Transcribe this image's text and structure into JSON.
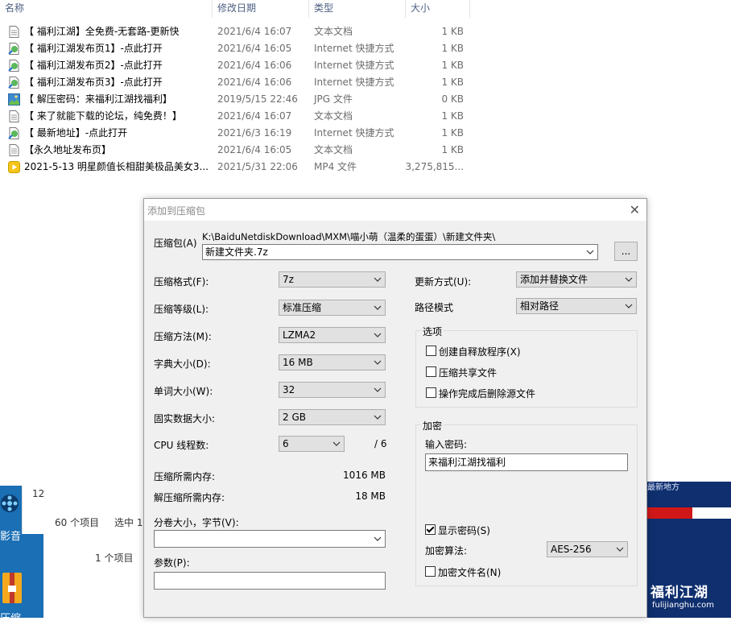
{
  "explorer": {
    "columns": {
      "name": "名称",
      "date": "修改日期",
      "type": "类型",
      "size": "大小"
    },
    "files": [
      {
        "name": "【 福利江湖】全免费-无套路-更新快",
        "date": "2021/6/4 16:07",
        "type": "文本文档",
        "size": "1 KB",
        "icon": "text-file"
      },
      {
        "name": "【 福利江湖发布页1】-点此打开",
        "date": "2021/6/4 16:05",
        "type": "Internet 快捷方式",
        "size": "1 KB",
        "icon": "internet-shortcut"
      },
      {
        "name": "【 福利江湖发布页2】-点此打开",
        "date": "2021/6/4 16:06",
        "type": "Internet 快捷方式",
        "size": "1 KB",
        "icon": "internet-shortcut"
      },
      {
        "name": "【 福利江湖发布页3】-点此打开",
        "date": "2021/6/4 16:06",
        "type": "Internet 快捷方式",
        "size": "1 KB",
        "icon": "internet-shortcut"
      },
      {
        "name": "【 解压密码：来福利江湖找福利】",
        "date": "2019/5/15 22:46",
        "type": "JPG 文件",
        "size": "0 KB",
        "icon": "image-file"
      },
      {
        "name": "【 来了就能下载的论坛，纯免费！】",
        "date": "2021/6/4 16:07",
        "type": "文本文档",
        "size": "1 KB",
        "icon": "text-file"
      },
      {
        "name": "【 最新地址】-点此打开",
        "date": "2021/6/3 16:19",
        "type": "Internet 快捷方式",
        "size": "1 KB",
        "icon": "internet-shortcut"
      },
      {
        "name": "【永久地址发布页】",
        "date": "2021/6/4 16:05",
        "type": "文本文档",
        "size": "1 KB",
        "icon": "text-file"
      },
      {
        "name": "2021-5-13 明星颜值长相甜美极品美女3...",
        "date": "2021/5/31 22:06",
        "type": "MP4 文件",
        "size": "3,275,815...",
        "icon": "video-file"
      }
    ]
  },
  "background": {
    "desktop_label_1": "影音",
    "desktop_label_2": "压缩",
    "window_a_number": "12",
    "window_a_status_items": "60 个项目",
    "window_a_status_selected": "选中 1",
    "window_b_status": "1 个项目",
    "right_banner_text": "最新地方",
    "logo_text": "福利江湖",
    "logo_url": "fulijianghu.com"
  },
  "dialog": {
    "title": "添加到压缩包",
    "archive_label": "压缩包(A)",
    "archive_path": "K:\\BaiduNetdiskDownload\\MXM\\喵小萌（温柔的蛋蛋）\\新建文件夹\\",
    "archive_name": "新建文件夹.7z",
    "browse_label": "...",
    "format_label": "压缩格式(F):",
    "format_value": "7z",
    "level_label": "压缩等级(L):",
    "level_value": "标准压缩",
    "method_label": "压缩方法(M):",
    "method_value": "LZMA2",
    "dict_label": "字典大小(D):",
    "dict_value": "16 MB",
    "word_label": "单词大小(W):",
    "word_value": "32",
    "solid_label": "固实数据大小:",
    "solid_value": "2 GB",
    "threads_label": "CPU 线程数:",
    "threads_value": "6",
    "threads_max": "/ 6",
    "mem_compress_label": "压缩所需内存:",
    "mem_compress_value": "1016 MB",
    "mem_decompress_label": "解压缩所需内存:",
    "mem_decompress_value": "18 MB",
    "split_label": "分卷大小，字节(V):",
    "split_value": "",
    "params_label": "参数(P):",
    "params_value": "",
    "update_label": "更新方式(U):",
    "update_value": "添加并替换文件",
    "path_mode_label": "路径模式",
    "path_mode_value": "相对路径",
    "options_group": "选项",
    "opt_sfx": "创建自释放程序(X)",
    "opt_shared": "压缩共享文件",
    "opt_delete": "操作完成后删除源文件",
    "encrypt_group": "加密",
    "password_label": "输入密码:",
    "password_value": "来福利江湖找福利",
    "show_password": "显示密码(S)",
    "enc_method_label": "加密算法:",
    "enc_method_value": "AES-256",
    "enc_names": "加密文件名(N)"
  },
  "colors": {
    "header_text": "#4d6082",
    "dialog_bg": "#f0f0f0",
    "desktop_blue": "#1a6fb5"
  }
}
